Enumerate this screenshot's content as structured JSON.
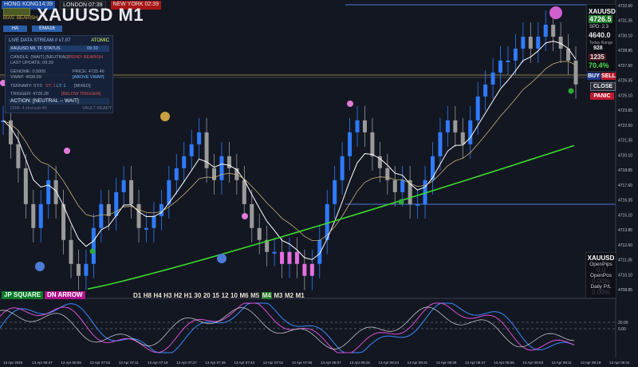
{
  "clocks": {
    "hk": "HONG KONG14:39",
    "ldn": "LONDON 07:39",
    "ny": "NEW YORK",
    "ny_time": "02:39"
  },
  "title": "XAUUSD M1",
  "bias": "BIAS: BEARISH",
  "mini_buttons": [
    "HA",
    "EMA16"
  ],
  "panel": {
    "header": "LIVE DATA STREAM // v7.07",
    "header_right": "ATOMIC",
    "tf_status": "XAUUSD M1 TF STATUS",
    "tf_time": "09:39",
    "candle": "CANDLE: (WAIT) [NEUTRAL]",
    "trend": "TREND: BEARISH",
    "last_update": "LAST UPDATE: 09:39",
    "genome": "GENOME: 0.5000",
    "vwap": "VWAP: 4699.69",
    "price": "PRICE: 4725.46",
    "above_vwap": "[ABOVE VWAP]",
    "ternary": "TERNARY: ST:0",
    "st_value": "ST: 1",
    "lt_value": "LT: 1",
    "mixed": "[MIXED]",
    "trigger": "TRIGGER: 4726.28",
    "below_trigger": "[BELOW TRIGGER]",
    "action": "ACTION: [NEUTRAL -- WAIT]",
    "footer_left": "DSN: 4 Hrs/sub:45",
    "footer_right": "VAULT READY"
  },
  "right_box": {
    "symbol": "XAUUSD",
    "price": "4726.5",
    "spread_label": "SPD: 2.3",
    "value2": "4640.0",
    "range_label": "Today Range",
    "range_value": "928",
    "adr_value": "1235",
    "pct": "70.4%"
  },
  "buttons": {
    "buy": "BUY",
    "sell": "SELL",
    "close": "CLOSE",
    "panic": "PANIC"
  },
  "stats": {
    "symbol": "XAUUSD",
    "open_pips": "OpenPips",
    "open_pips_val": "0.0",
    "open_pos": "OpenPos",
    "open_pos_val": "0.00%",
    "daily_pl": "Daily P/L",
    "daily_pl_val": "0.00%"
  },
  "strips": {
    "jp": "JP SQUARE",
    "dn": "DN ARROW"
  },
  "timeframes": [
    "D1",
    "H8",
    "H4",
    "H3",
    "H2",
    "H1",
    "30",
    "20",
    "15",
    "12",
    "10",
    "M6",
    "M5",
    "M4",
    "M3",
    "M2",
    "M1"
  ],
  "chart_data": {
    "type": "candlestick",
    "price_axis": [
      "4732.60",
      "4731.35",
      "4730.10",
      "4728.85",
      "4727.60",
      "4726.35",
      "4725.10",
      "4723.85",
      "4722.60",
      "4721.35",
      "4720.10",
      "4718.85",
      "4717.60",
      "4716.35",
      "4715.10",
      "4713.85",
      "4712.60",
      "4711.35",
      "4710.10",
      "4708.85"
    ],
    "time_axis": [
      "13 Apr 2026",
      "13 Apr 06:47",
      "13 Apr 06:55",
      "13 Apr 07:03",
      "13 Apr 07:11",
      "13 Apr 07:19",
      "13 Apr 07:27",
      "13 Apr 07:35",
      "13 Apr 07:43",
      "13 Apr 07:51",
      "13 Apr 07:59",
      "13 Apr 08:07",
      "13 Apr 08:15",
      "13 Apr 08:23",
      "13 Apr 08:31",
      "13 Apr 08:39",
      "13 Apr 08:47",
      "13 Apr 08:55",
      "13 Apr 09:03",
      "13 Apr 09:11",
      "13 Apr 09:19",
      "13 Apr 09:31"
    ],
    "close_series": [
      4723,
      4721,
      4719,
      4716,
      4714,
      4716,
      4718,
      4716,
      4713,
      4711,
      4710,
      4711,
      4714,
      4716,
      4715,
      4717,
      4718,
      4716,
      4714,
      4714,
      4715,
      4716,
      4718,
      4719,
      4720,
      4721,
      4722,
      4719,
      4718,
      4720,
      4719,
      4718,
      4716,
      4714,
      4713,
      4712,
      4712,
      4711,
      4712,
      4711,
      4710,
      4711,
      4713,
      4716,
      4718,
      4720,
      4722,
      4723,
      4722,
      4720,
      4719,
      4718,
      4717,
      4718,
      4716,
      4716,
      4718,
      4720,
      4722,
      4723,
      4722,
      4721,
      4723,
      4725,
      4726,
      4727,
      4728,
      4728,
      4729,
      4730,
      4729,
      4730,
      4731,
      4730,
      4729,
      4728,
      4726
    ],
    "reference_lines": [
      4732.6,
      4725.8,
      4715.9
    ],
    "oscillator_levels": [
      "20.00",
      "0.00"
    ]
  },
  "colors": {
    "bull": "#2f7bff",
    "bear": "#9a9a9a",
    "pink": "#e46ee0",
    "green_ma": "#3bdc2c",
    "white_ma": "#ffffff",
    "hline": "#4a7bd1"
  }
}
